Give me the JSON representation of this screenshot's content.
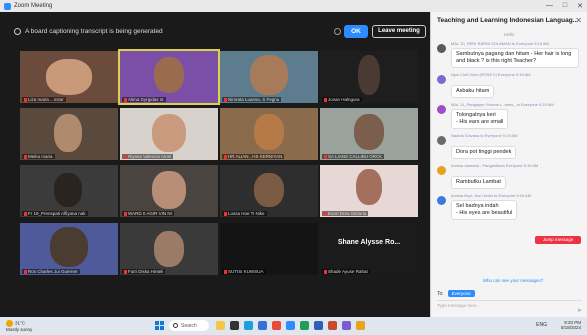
{
  "window": {
    "title": "Zoom Meeting"
  },
  "banner": {
    "message": "A board captioning transcript is being generated",
    "ok_label": "OK",
    "leave_label": "Leave meeting"
  },
  "tiles": [
    {
      "name": "Liza maria ...nstor",
      "big": ""
    },
    {
      "name": "Alima Gyrgidas nt",
      "big": ""
    },
    {
      "name": "Nimrata Luansa, S Fegnu",
      "big": ""
    },
    {
      "name": "Jovan Halngura",
      "big": ""
    },
    {
      "name": "Meika maria",
      "big": ""
    },
    {
      "name": "Riyasa Valencia Amel",
      "big": ""
    },
    {
      "name": "HR ALIAN...HS KERNIYAN",
      "big": ""
    },
    {
      "name": "SA LIANS CALLIBU ORCK",
      "big": ""
    },
    {
      "name": "Fr 19_Prenspati Alfiyana nak",
      "big": ""
    },
    {
      "name": "WARD II AGIR VIN NI",
      "big": ""
    },
    {
      "name": "Lossa Hoe Ti Nike",
      "big": ""
    },
    {
      "name": "Eunri Drea Gilduria",
      "big": ""
    },
    {
      "name": "Ros Charles Jui Guerner",
      "big": ""
    },
    {
      "name": "Futri Diska Hinteli",
      "big": ""
    },
    {
      "name": "SUTISI KUWSUA",
      "big": ""
    },
    {
      "name": "Shade Ayuse Rahat",
      "big": "Shane Alysse Ro..."
    }
  ],
  "chat": {
    "title": "Teaching and Learning Indonesian Languag...",
    "sub": "Hello",
    "messages": [
      {
        "meta": "MAL 10_RENI RARNI SOLAMAN to Everyone 9:19 AM",
        "text": "Sambutnya pagang dan hitam - Her hair is long and black ? is this right Teacher?",
        "color": "#5a5a5a"
      },
      {
        "meta": "Nyoi Cinti Dinni (ROSE II) Everyone 9:19 AM",
        "text": "Asbaku hitam",
        "color": "#7a6bd0"
      },
      {
        "meta": "MAL 11_Pangayan Yvonne L. anes_ to Everyone 9:19 AM",
        "text": "Tolongalnya keri\n- His ears are small",
        "color": "#a24cc9"
      },
      {
        "meta": "Nadhia Solvana to Everyone 9:19 AM",
        "text": "Dora pot tinggi pendek",
        "color": "#6b6b6b"
      },
      {
        "meta": "Annisa dannata - Pangestiuna Everyone 9:19 AM",
        "text": "Rambutku Lambat",
        "color": "#e6a21a"
      },
      {
        "meta": "Annisa Bryx, Ace Uedel to Everyone 9:19 AM",
        "text": "Sel badnya indah\n- His eyes are beautiful",
        "color": "#3b7ad8"
      }
    ],
    "red_pill": "Jump message",
    "who_label": "Who can see your messages?",
    "to_label": "To:",
    "to_value": "Everyone",
    "input_placeholder": "Type message here..."
  },
  "taskbar": {
    "weather_temp": "31°C",
    "weather_desc": "Mostly sunny",
    "search_label": "Search",
    "time": "9:20 PM",
    "date": "8/18/2024",
    "lang": "ENG"
  }
}
